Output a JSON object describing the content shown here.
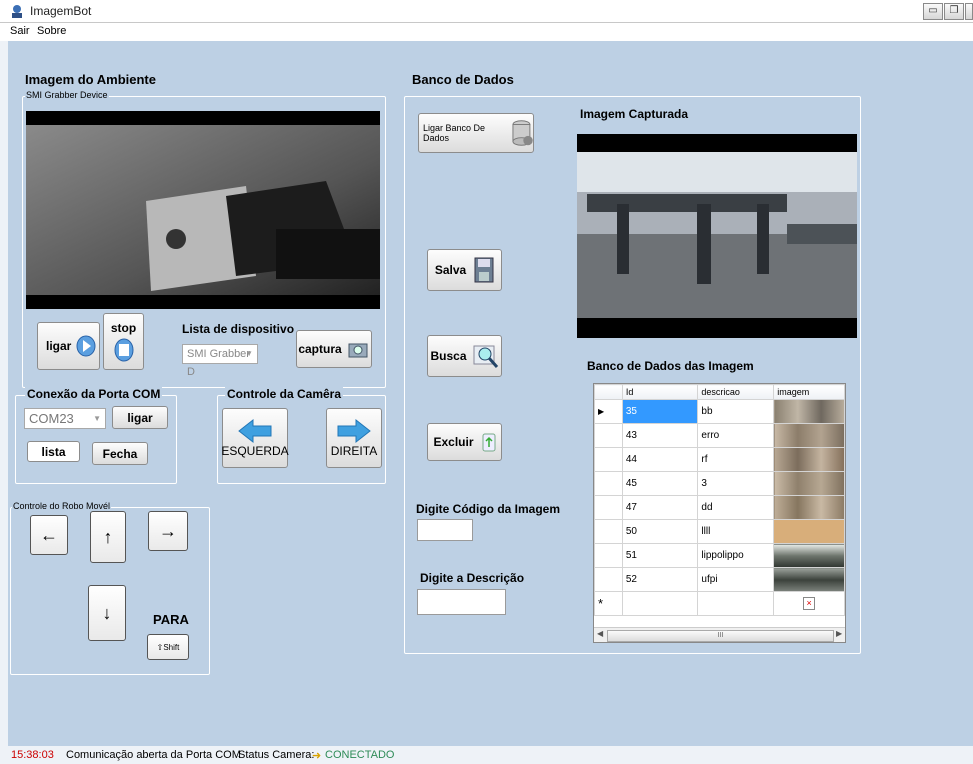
{
  "window": {
    "title": "ImagemBot"
  },
  "menu": {
    "items": [
      "Sair",
      "Sobre"
    ]
  },
  "left": {
    "section_title": "Imagem do Ambiente",
    "grabber_group_label": "SMI Grabber Device",
    "ligar_label": "ligar",
    "stop_label": "stop",
    "device_list_label": "Lista de dispositivo",
    "device_select_value": "SMI Grabber D",
    "captura_label": "captura",
    "com": {
      "group_label": "Conexão da Porta COM",
      "port_value": "COM23",
      "ligar_label": "ligar",
      "lista_label": "lista",
      "fecha_label": "Fecha"
    },
    "camera": {
      "group_label": "Controle da Camêra",
      "left_label": "ESQUERDA",
      "right_label": "DIREITA"
    },
    "robot": {
      "group_label": "Controle do Robo Movél",
      "stop_label": "PARA",
      "shift_label": "⇧Shift",
      "arrows": {
        "left": "←",
        "up": "↑",
        "right": "→",
        "down": "↓"
      }
    }
  },
  "db": {
    "section_title": "Banco de Dados",
    "connect_label": "Ligar Banco De Dados",
    "captured_title": "Imagem Capturada",
    "save_label": "Salva",
    "search_label": "Busca",
    "delete_label": "Excluir",
    "code_label": "Digite Código da Imagem",
    "code_value": "",
    "desc_label": "Digite a Descrição",
    "desc_value": "",
    "grid_title": "Banco de Dados das Imagem",
    "columns": [
      "Id",
      "descricao",
      "imagem"
    ],
    "rows": [
      {
        "id": "35",
        "desc": "bb"
      },
      {
        "id": "43",
        "desc": "erro"
      },
      {
        "id": "44",
        "desc": "rf"
      },
      {
        "id": "45",
        "desc": "3"
      },
      {
        "id": "47",
        "desc": "dd"
      },
      {
        "id": "50",
        "desc": "llll"
      },
      {
        "id": "51",
        "desc": "lippolippo"
      },
      {
        "id": "52",
        "desc": "ufpi"
      }
    ],
    "new_row_marker": "*",
    "scroll_mid": "III"
  },
  "status": {
    "time": "15:38:03",
    "message": "Comunicação aberta da Porta COM",
    "camera_label": "Status Camera:",
    "camera_state": "CONECTADO",
    "time_color": "#cc0000",
    "state_color": "#2e8b57"
  }
}
